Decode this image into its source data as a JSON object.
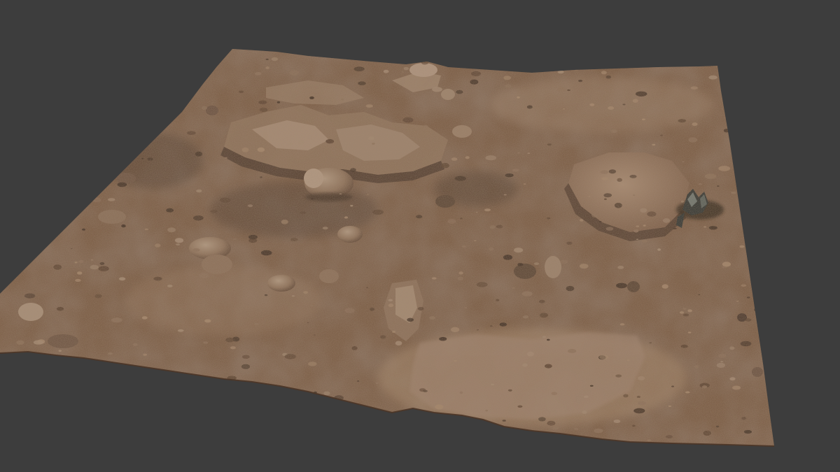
{
  "viewport": {
    "background_color": "#3d3d3d",
    "object": "terrain-scan-mesh",
    "surface_colors": {
      "soil_base": "#7a5c44",
      "soil_dark": "#5a4230",
      "soil_light": "#a5876b",
      "rock_light": "#a48a72",
      "rock_mid": "#8c7059",
      "rock_shadow": "#3e2e22",
      "plant_dark": "#2f3431",
      "plant_light": "#6d7670"
    },
    "features": [
      "rocky-outcrop-top-left",
      "boulder-cluster-center",
      "flat-rock-slab-right",
      "small-shrub-right",
      "scattered-pebbles",
      "pale-rock-slab-bottom-center"
    ]
  }
}
